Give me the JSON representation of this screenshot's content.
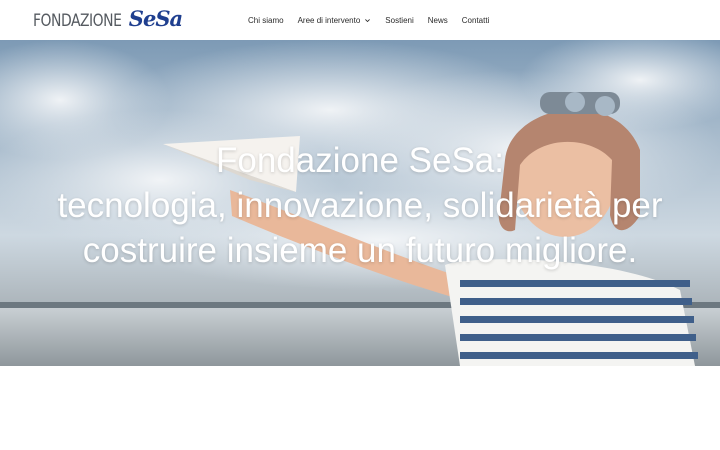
{
  "logo": {
    "text": "FONDAZIONE",
    "brand": "SeSa"
  },
  "nav": {
    "items": [
      {
        "label": "Chi siamo",
        "has_dropdown": false
      },
      {
        "label": "Aree di intervento",
        "has_dropdown": true
      },
      {
        "label": "Sostieni",
        "has_dropdown": false
      },
      {
        "label": "News",
        "has_dropdown": false
      },
      {
        "label": "Contatti",
        "has_dropdown": false
      }
    ]
  },
  "hero": {
    "title_lines": [
      "Fondazione SeSa:",
      "tecnologia, innovazione, solidarietà per",
      "costruire insieme un futuro migliore."
    ],
    "image_description_icon": "boy-paper-plane-photo"
  },
  "colors": {
    "brand_blue": "#1f3f8f",
    "logo_gray": "#555a60",
    "nav_text": "#2a2a2a",
    "hero_text": "#ffffff"
  }
}
